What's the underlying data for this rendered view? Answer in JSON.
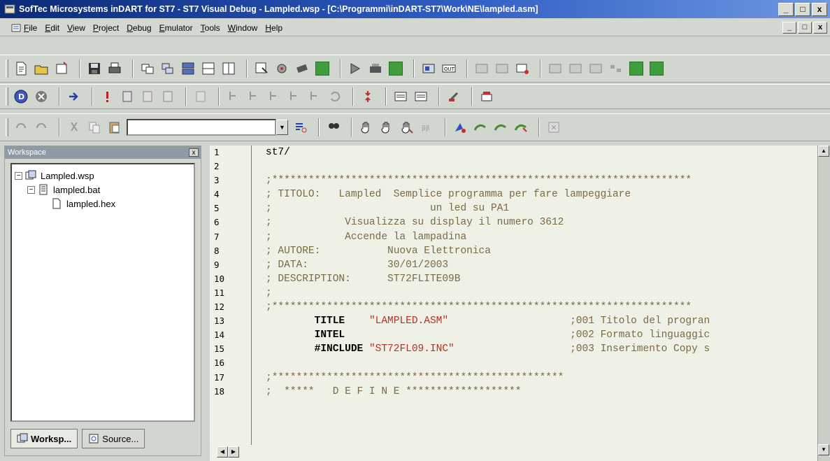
{
  "window": {
    "title": "SofTec Microsystems inDART for ST7 - ST7 Visual Debug - Lampled.wsp - [C:\\Programmi\\inDART-ST7\\Work\\NE\\lampled.asm]",
    "buttons": [
      "_",
      "□",
      "x"
    ]
  },
  "menu": {
    "items": [
      "File",
      "Edit",
      "View",
      "Project",
      "Debug",
      "Emulator",
      "Tools",
      "Window",
      "Help"
    ],
    "mdi_buttons": [
      "_",
      "□",
      "x"
    ]
  },
  "toolbar3": {
    "combo_value": ""
  },
  "workspace": {
    "title": "Workspace",
    "close": "x",
    "tree": [
      {
        "label": "Lampled.wsp",
        "toggle": "−",
        "icon": "workspace-icon",
        "indent": 0
      },
      {
        "label": "lampled.bat",
        "toggle": "−",
        "icon": "batch-file-icon",
        "indent": 1
      },
      {
        "label": "lampled.hex",
        "toggle": "",
        "icon": "hex-file-icon",
        "indent": 2
      }
    ],
    "tabs": [
      "Worksp...",
      "Source..."
    ]
  },
  "editor": {
    "line_numbers": [
      "1",
      "2",
      "3",
      "4",
      "5",
      "6",
      "7",
      "8",
      "9",
      "10",
      "11",
      "12",
      "13",
      "14",
      "15",
      "16",
      "17",
      "18"
    ],
    "lines": [
      [
        {
          "t": "st7/",
          "c": "text"
        }
      ],
      [
        {
          "t": "",
          "c": "text"
        }
      ],
      [
        {
          "t": ";*********************************************************************",
          "c": "comment"
        }
      ],
      [
        {
          "t": "; TITOLO:   Lampled  Semplice programma per fare lampeggiare",
          "c": "comment"
        }
      ],
      [
        {
          "t": ";                          un led su PA1",
          "c": "comment"
        }
      ],
      [
        {
          "t": ";            Visualizza su display il numero 3612",
          "c": "comment"
        }
      ],
      [
        {
          "t": ";            Accende la lampadina",
          "c": "comment"
        }
      ],
      [
        {
          "t": "; AUTORE:           Nuova Elettronica",
          "c": "comment"
        }
      ],
      [
        {
          "t": "; DATA:             30/01/2003",
          "c": "comment"
        }
      ],
      [
        {
          "t": "; DESCRIPTION:      ST72FLITE09B",
          "c": "comment"
        }
      ],
      [
        {
          "t": ";",
          "c": "comment"
        }
      ],
      [
        {
          "t": ";*********************************************************************",
          "c": "comment"
        }
      ],
      [
        {
          "t": "        TITLE    ",
          "c": "kw"
        },
        {
          "t": "\"LAMPLED.ASM\"",
          "c": "str"
        },
        {
          "t": "                    ;001 Titolo del progran",
          "c": "comment"
        }
      ],
      [
        {
          "t": "        INTEL",
          "c": "kw"
        },
        {
          "t": "                                     ;002 Formato linguaggic",
          "c": "comment"
        }
      ],
      [
        {
          "t": "        #INCLUDE ",
          "c": "kw"
        },
        {
          "t": "\"ST72FL09.INC\"",
          "c": "str"
        },
        {
          "t": "                   ;003 Inserimento Copy s",
          "c": "comment"
        }
      ],
      [
        {
          "t": "",
          "c": "text"
        }
      ],
      [
        {
          "t": ";************************************************",
          "c": "comment"
        }
      ],
      [
        {
          "t": ";  *****   D E F I N E *******************",
          "c": "comment"
        }
      ]
    ]
  },
  "colors": {
    "titlebar": "#0a2a78",
    "comment": "#7a6a42",
    "string": "#b03424",
    "toolbar_green": "#3e9e3e"
  }
}
